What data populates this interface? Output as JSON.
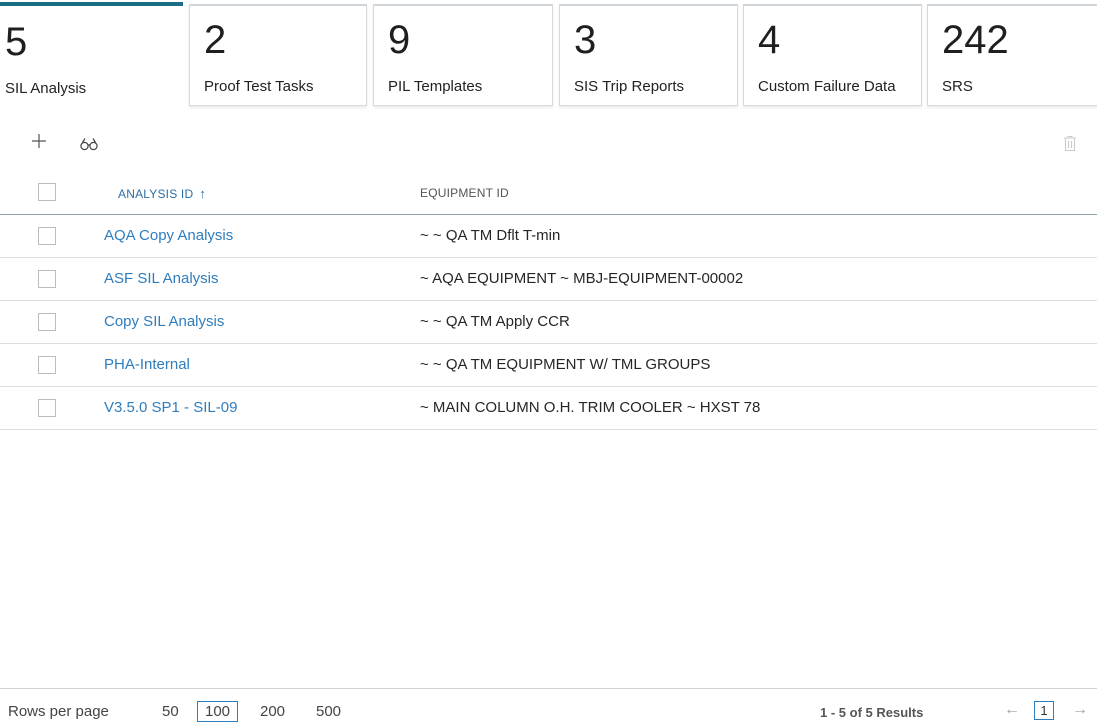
{
  "tiles": [
    {
      "count": "5",
      "label": "SIL Analysis"
    },
    {
      "count": "2",
      "label": "Proof Test Tasks"
    },
    {
      "count": "9",
      "label": "PIL Templates"
    },
    {
      "count": "3",
      "label": "SIS Trip Reports"
    },
    {
      "count": "4",
      "label": "Custom Failure Data"
    },
    {
      "count": "242",
      "label": "SRS"
    }
  ],
  "toolbar": {
    "add_icon": "plus-icon",
    "search_icon": "binoculars-icon",
    "delete_icon": "trash-icon"
  },
  "table": {
    "columns": [
      "ANALYSIS ID",
      "EQUIPMENT ID"
    ],
    "sort_indicator": "↑",
    "rows": [
      {
        "analysis_id": "AQA Copy Analysis",
        "equipment_id": "~ ~ QA TM Dflt T-min"
      },
      {
        "analysis_id": "ASF SIL Analysis",
        "equipment_id": "~ AQA EQUIPMENT ~ MBJ-EQUIPMENT-00002"
      },
      {
        "analysis_id": "Copy SIL Analysis",
        "equipment_id": "~ ~ QA TM Apply CCR"
      },
      {
        "analysis_id": "PHA-Internal",
        "equipment_id": "~ ~ QA TM EQUIPMENT W/ TML GROUPS"
      },
      {
        "analysis_id": "V3.5.0 SP1 - SIL-09",
        "equipment_id": "~ MAIN COLUMN O.H. TRIM COOLER ~ HXST 78"
      }
    ]
  },
  "footer": {
    "rows_per_page_label": "Rows per page",
    "options": [
      "50",
      "100",
      "200",
      "500"
    ],
    "selected_option": "100",
    "results_text": "1 - 5 of 5 Results",
    "prev_arrow": "←",
    "current_page": "1",
    "next_arrow": "→"
  },
  "colors": {
    "accent": "#1b6d85",
    "link": "#2f7dbd"
  }
}
